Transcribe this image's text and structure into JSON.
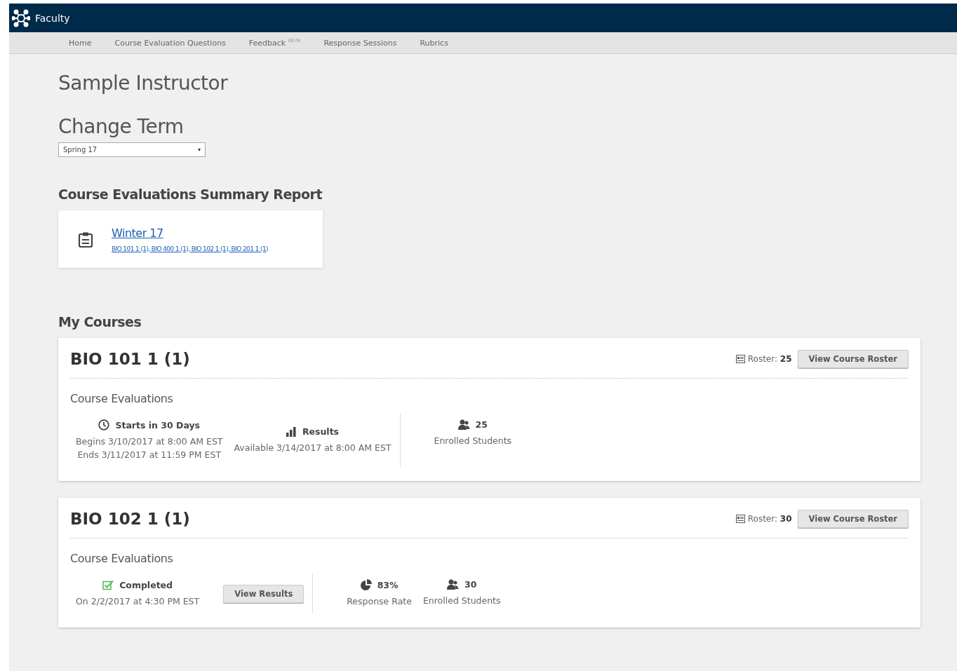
{
  "app_bar": {
    "title": "Faculty"
  },
  "nav": [
    {
      "label": "Home"
    },
    {
      "label": "Course Evaluation Questions"
    },
    {
      "label": "Feedback $^{BETA}$"
    },
    {
      "label": "Response Sessions"
    },
    {
      "label": "Rubrics"
    }
  ],
  "instructor_name": "Sample Instructor",
  "change_term": {
    "heading": "Change Term",
    "value": "Spring 17"
  },
  "summary_report": {
    "heading": "Course Evaluations Summary Report",
    "term_link": "Winter 17",
    "courses_link": "BIO 101 1 (1), BIO 400 1 (1), BIO 102 1 (1), BIO 201 1 (1)"
  },
  "my_courses": {
    "heading": "My Courses",
    "courses": [
      {
        "title": "BIO 101 1 (1)",
        "roster_label": "Roster:",
        "roster_count": "25",
        "roster_button": "View Course Roster",
        "section_title": "Course Evaluations",
        "evaluation": {
          "kind": "upcoming",
          "heading": "Starts in 30 Days",
          "lines": [
            "Begins 3/10/2017 at 8:00 AM EST",
            "Ends 3/11/2017 at 11:59 PM EST"
          ]
        },
        "results": {
          "heading": "Results",
          "lines": [
            "Available 3/14/2017 at 8:00 AM EST"
          ]
        },
        "stats": [
          {
            "kind": "enrolled",
            "value": "25",
            "label": "Enrolled Students"
          }
        ]
      },
      {
        "title": "BIO 102 1 (1)",
        "roster_label": "Roster:",
        "roster_count": "30",
        "roster_button": "View Course Roster",
        "section_title": "Course Evaluations",
        "evaluation": {
          "kind": "completed",
          "heading": "Completed",
          "lines": [
            "On 2/2/2017 at 4:30 PM EST"
          ]
        },
        "results_button": "View Results",
        "stats": [
          {
            "kind": "response_rate",
            "value": "83%",
            "label": "Response Rate"
          },
          {
            "kind": "enrolled",
            "value": "30",
            "label": "Enrolled Students"
          }
        ]
      }
    ]
  }
}
